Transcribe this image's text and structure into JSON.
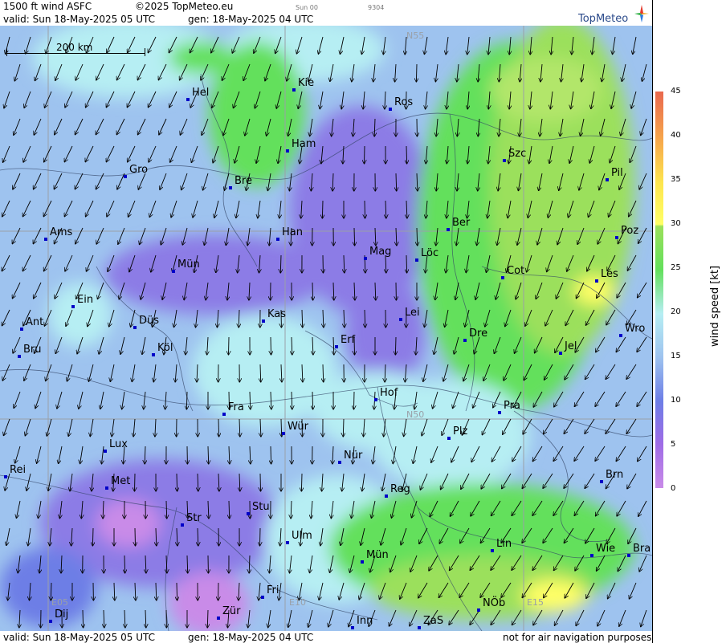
{
  "header": {
    "product": "1500 ft wind ASFC",
    "copyright": "©2025 TopMeteo.eu",
    "step": "Sun 00",
    "code": "9304",
    "valid": "valid:  Sun  18-May-2025  05 UTC",
    "gen": "gen: 18-May-2025 04 UTC"
  },
  "logo": {
    "text": "TopMeteo"
  },
  "scale": {
    "label": "200 km"
  },
  "grid_labels": [
    "N55",
    "N50",
    "E05",
    "E10",
    "E15"
  ],
  "cities": [
    "Kie",
    "Hel",
    "Ros",
    "Ham",
    "Szc",
    "Gro",
    "Bre",
    "Pil",
    "Ams",
    "Han",
    "Ber",
    "Poz",
    "Mag",
    "Löc",
    "Mün",
    "Cot",
    "Les",
    "Ein",
    "Kas",
    "Lei",
    "Ant",
    "Düs",
    "Wro",
    "Dre",
    "Erf",
    "Bru",
    "Köl",
    "Jel",
    "Hof",
    "Fra",
    "Pra",
    "Wür",
    "Plz",
    "Lux",
    "Nür",
    "Rei",
    "Brn",
    "Met",
    "Reg",
    "Stu",
    "Str",
    "Lin",
    "Ulm",
    "Wie",
    "Bra",
    "Mün",
    "Fri",
    "NÖb",
    "Dij",
    "Zür",
    "Inn",
    "ZaS"
  ],
  "footer": {
    "valid": "valid:  Sun  18-May-2025  05 UTC",
    "gen": "gen: 18-May-2025 04 UTC",
    "note": "not for air navigation purposes"
  },
  "legend": {
    "unit_label": "wind speed [kt]",
    "ticks": [
      "45",
      "40",
      "35",
      "30",
      "25",
      "20",
      "15",
      "10",
      "5",
      "0"
    ],
    "colors": {
      "c0": "#c98be8",
      "c5": "#9f6ce6",
      "c10": "#6d7ee6",
      "c15": "#9ec3ef",
      "c20": "#b6eef3",
      "c25": "#63e05c",
      "c30": "#ffff66",
      "c35": "#fde54e",
      "c40": "#f6a64c",
      "c45": "#e9684e"
    }
  }
}
